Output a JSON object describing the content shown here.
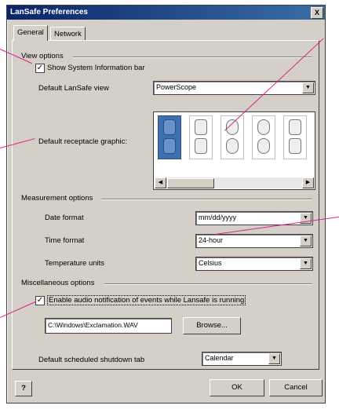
{
  "window": {
    "title": "LanSafe Preferences",
    "close_glyph": "X"
  },
  "tabs": [
    {
      "label": "General"
    },
    {
      "label": "Network"
    }
  ],
  "view_options": {
    "heading": "View options",
    "show_info_bar": {
      "label": "Show System Information bar",
      "checked": true
    },
    "default_view": {
      "label": "Default LanSafe view",
      "value": "PowerScope"
    },
    "receptacle": {
      "label": "Default receptacle graphic:"
    }
  },
  "measurement": {
    "heading": "Measurement options",
    "date_format": {
      "label": "Date format",
      "value": "mm/dd/yyyy"
    },
    "time_format": {
      "label": "Time format",
      "value": "24-hour"
    },
    "temperature": {
      "label": "Temperature units",
      "value": "Celsius"
    }
  },
  "misc": {
    "heading": "Miscellaneous options",
    "audio": {
      "label": "Enable audio notification of events while Lansafe is running",
      "checked": true
    },
    "sound_file": "C:\\Windows\\Exclamation.WAV",
    "browse_label": "Browse...",
    "shutdown": {
      "label": "Default scheduled shutdown tab",
      "value": "Calendar"
    }
  },
  "footer": {
    "help_label": "?",
    "ok_label": "OK",
    "cancel_label": "Cancel"
  },
  "colors": {
    "callout": "#e0208a",
    "title_bar": "#0a246a"
  }
}
